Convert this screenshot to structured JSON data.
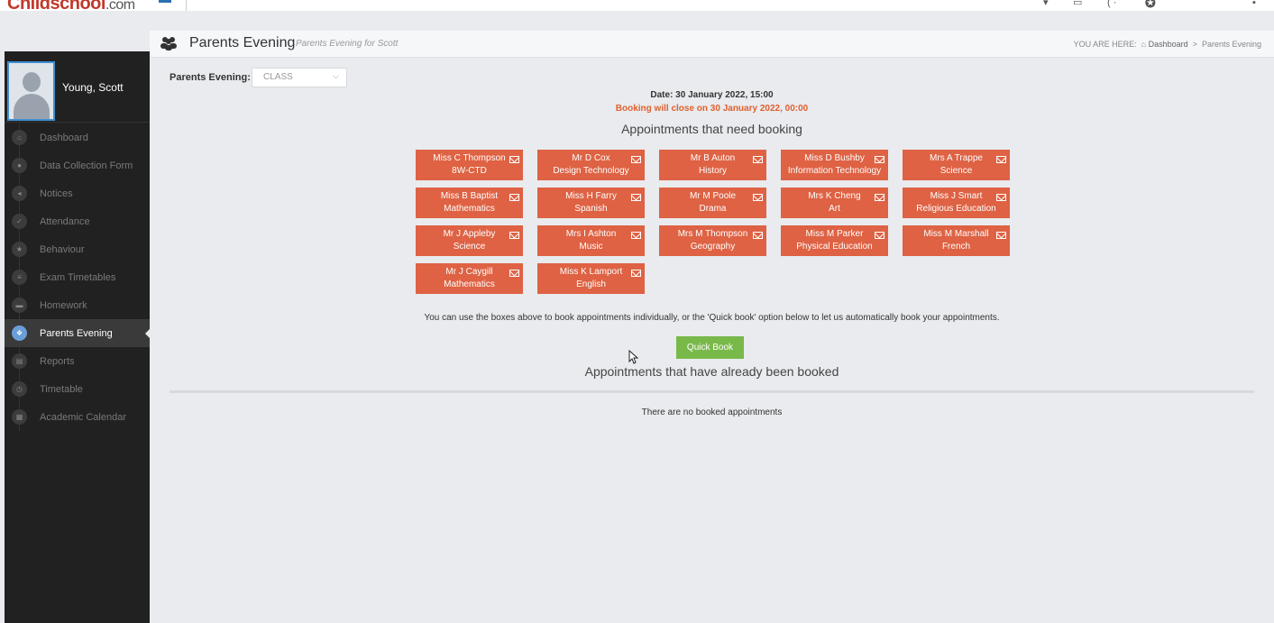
{
  "topbar": {
    "logo_main": "Childschool",
    "logo_suffix": ".com"
  },
  "page_header": {
    "title": "Parents Evening",
    "subtitle": "Parents Evening for Scott",
    "breadcrumb_prefix": "YOU ARE HERE:",
    "breadcrumb_home": "Dashboard",
    "breadcrumb_sep": ">",
    "breadcrumb_current": "Parents Evening"
  },
  "profile": {
    "name": "Young, Scott"
  },
  "nav": [
    {
      "label": "Dashboard",
      "icon": "home-icon"
    },
    {
      "label": "Data Collection Form",
      "icon": "user-icon"
    },
    {
      "label": "Notices",
      "icon": "megaphone-icon"
    },
    {
      "label": "Attendance",
      "icon": "check-icon"
    },
    {
      "label": "Behaviour",
      "icon": "star-icon"
    },
    {
      "label": "Exam Timetables",
      "icon": "list-icon"
    },
    {
      "label": "Homework",
      "icon": "briefcase-icon"
    },
    {
      "label": "Parents Evening",
      "icon": "group-icon",
      "active": true
    },
    {
      "label": "Reports",
      "icon": "document-icon"
    },
    {
      "label": "Timetable",
      "icon": "clock-icon"
    },
    {
      "label": "Academic Calendar",
      "icon": "calendar-icon"
    }
  ],
  "filter": {
    "label": "Parents Evening:",
    "selected": "CLASS"
  },
  "event": {
    "date_text": "Date: 30 January 2022, 15:00",
    "closing_text": "Booking will close on 30 January 2022, 00:00"
  },
  "need_booking_heading": "Appointments that need booking",
  "appointments": [
    {
      "teacher": "Miss C Thompson",
      "subject": "8W-CTD"
    },
    {
      "teacher": "Mr D Cox",
      "subject": "Design Technology"
    },
    {
      "teacher": "Mr B Auton",
      "subject": "History"
    },
    {
      "teacher": "Miss D Bushby",
      "subject": "Information Technology"
    },
    {
      "teacher": "Mrs A Trappe",
      "subject": "Science"
    },
    {
      "teacher": "Miss B Baptist",
      "subject": "Mathematics"
    },
    {
      "teacher": "Miss H Farry",
      "subject": "Spanish"
    },
    {
      "teacher": "Mr M Poole",
      "subject": "Drama"
    },
    {
      "teacher": "Mrs K Cheng",
      "subject": "Art"
    },
    {
      "teacher": "Miss J Smart",
      "subject": "Religious Education"
    },
    {
      "teacher": "Mr J Appleby",
      "subject": "Science"
    },
    {
      "teacher": "Mrs I Ashton",
      "subject": "Music"
    },
    {
      "teacher": "Mrs M Thompson",
      "subject": "Geography"
    },
    {
      "teacher": "Miss M Parker",
      "subject": "Physical Education"
    },
    {
      "teacher": "Miss M Marshall",
      "subject": "French"
    },
    {
      "teacher": "Mr J Caygill",
      "subject": "Mathematics"
    },
    {
      "teacher": "Miss K Lamport",
      "subject": "English"
    }
  ],
  "help_text": "You can use the boxes above to book appointments individually, or the 'Quick book' option below to let us automatically book your appointments.",
  "quick_book_label": "Quick Book",
  "booked_heading": "Appointments that have already been booked",
  "no_booked_text": "There are no booked appointments",
  "colors": {
    "appointment_bg": "#de6243",
    "quick_book_bg": "#79b94a",
    "sidebar_bg": "#212122",
    "closing_text": "#e0602f"
  }
}
